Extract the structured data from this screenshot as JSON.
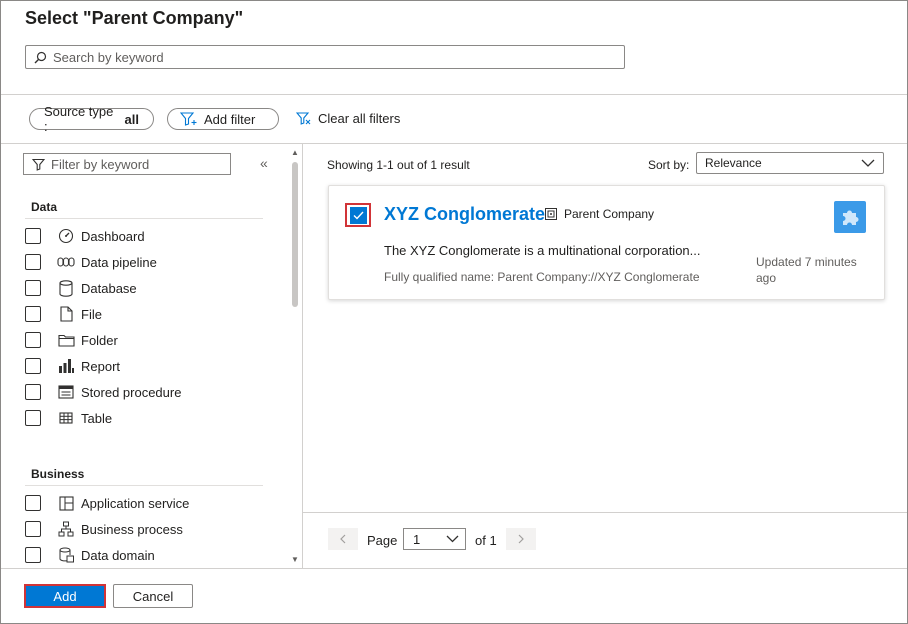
{
  "dialog": {
    "title": "Select \"Parent Company\"",
    "search_placeholder": "Search by keyword"
  },
  "filters": {
    "source_type_label": "Source type :",
    "source_type_value": "all",
    "add_filter": "Add filter",
    "clear_all": "Clear all filters"
  },
  "sidebar": {
    "filter_placeholder": "Filter by keyword",
    "collapse_glyph": "«",
    "data_heading": "Data",
    "data_items": [
      {
        "label": "Dashboard",
        "icon": "dashboard-icon"
      },
      {
        "label": "Data pipeline",
        "icon": "data-pipeline-icon"
      },
      {
        "label": "Database",
        "icon": "database-icon"
      },
      {
        "label": "File",
        "icon": "file-icon"
      },
      {
        "label": "Folder",
        "icon": "folder-icon"
      },
      {
        "label": "Report",
        "icon": "report-icon"
      },
      {
        "label": "Stored procedure",
        "icon": "stored-procedure-icon"
      },
      {
        "label": "Table",
        "icon": "table-icon"
      }
    ],
    "business_heading": "Business",
    "business_items": [
      {
        "label": "Application service",
        "icon": "application-service-icon"
      },
      {
        "label": "Business process",
        "icon": "business-process-icon"
      },
      {
        "label": "Data domain",
        "icon": "data-domain-icon"
      }
    ]
  },
  "results": {
    "summary": "Showing 1-1 out of 1 result",
    "sort_label": "Sort by:",
    "sort_value": "Relevance",
    "card": {
      "checked": true,
      "name": "XYZ Conglomerate",
      "type": "Parent Company",
      "description": "The XYZ Conglomerate is a multinational corporation...",
      "fqn": "Fully qualified name: Parent Company://XYZ Conglomerate",
      "updated": "Updated 7 minutes ago"
    }
  },
  "pager": {
    "page_label": "Page",
    "page_value": "1",
    "of_label": "of 1"
  },
  "footer": {
    "add": "Add",
    "cancel": "Cancel"
  },
  "colors": {
    "accent": "#0078d4",
    "highlight_border": "#d13438"
  }
}
